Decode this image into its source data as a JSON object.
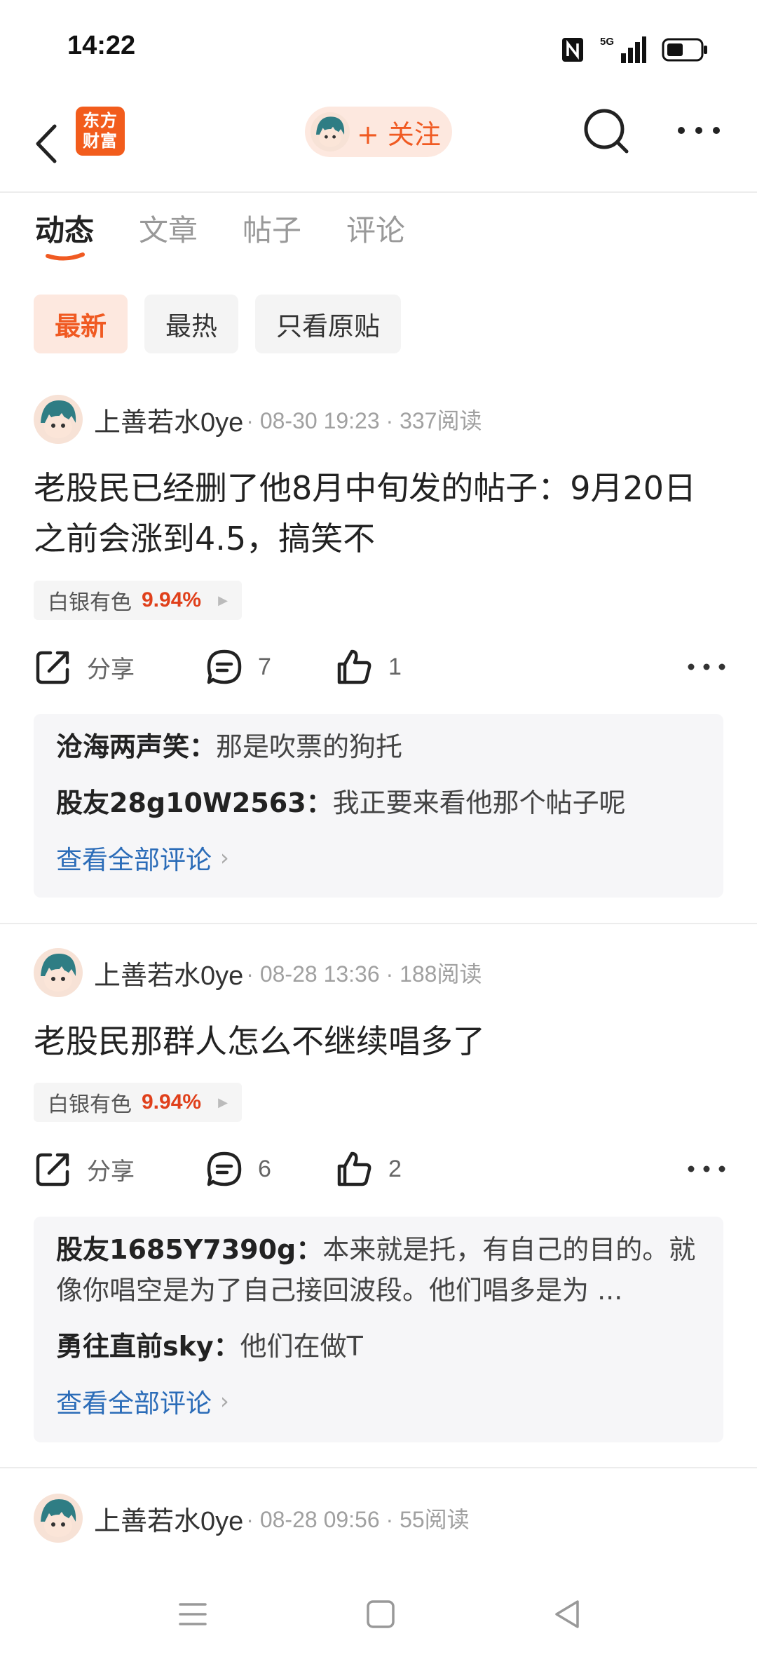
{
  "status": {
    "time": "14:22",
    "network": "5G"
  },
  "topbar": {
    "logo_line1": "东方",
    "logo_line2": "财富",
    "follow_label": "+ 关注"
  },
  "tabs": [
    {
      "label": "动态"
    },
    {
      "label": "文章"
    },
    {
      "label": "帖子"
    },
    {
      "label": "评论"
    }
  ],
  "filters": [
    {
      "label": "最新"
    },
    {
      "label": "最热"
    },
    {
      "label": "只看原贴"
    }
  ],
  "posts": [
    {
      "author": "上善若水0ye",
      "meta": "· 08-30 19:23 · 337阅读",
      "text": "老股民已经删了他8月中旬发的帖子：9月20日之前会涨到4.5，搞笑不",
      "stock_name": "白银有色",
      "stock_change": "9.94%",
      "share_label": "分享",
      "comment_count": "7",
      "like_count": "1",
      "comments": [
        {
          "author": "沧海两声笑：",
          "text": "那是吹票的狗托"
        },
        {
          "author": "股友28g10W2563：",
          "text": "我正要来看他那个帖子呢"
        }
      ],
      "view_all": "查看全部评论"
    },
    {
      "author": "上善若水0ye",
      "meta": "· 08-28 13:36 · 188阅读",
      "text": "老股民那群人怎么不继续唱多了",
      "stock_name": "白银有色",
      "stock_change": "9.94%",
      "share_label": "分享",
      "comment_count": "6",
      "like_count": "2",
      "comments": [
        {
          "author": "股友1685Y7390g：",
          "text": "本来就是托，有自己的目的。就像你唱空是为了自己接回波段。他们唱多是为 ..."
        },
        {
          "author": "勇往直前sky：",
          "text": "他们在做T"
        }
      ],
      "view_all": "查看全部评论"
    },
    {
      "author": "上善若水0ye",
      "meta": "· 08-28 09:56 · 55阅读"
    }
  ],
  "colors": {
    "accent": "#f05a22",
    "link": "#2b6cb8",
    "stock_up": "#e0401b"
  }
}
